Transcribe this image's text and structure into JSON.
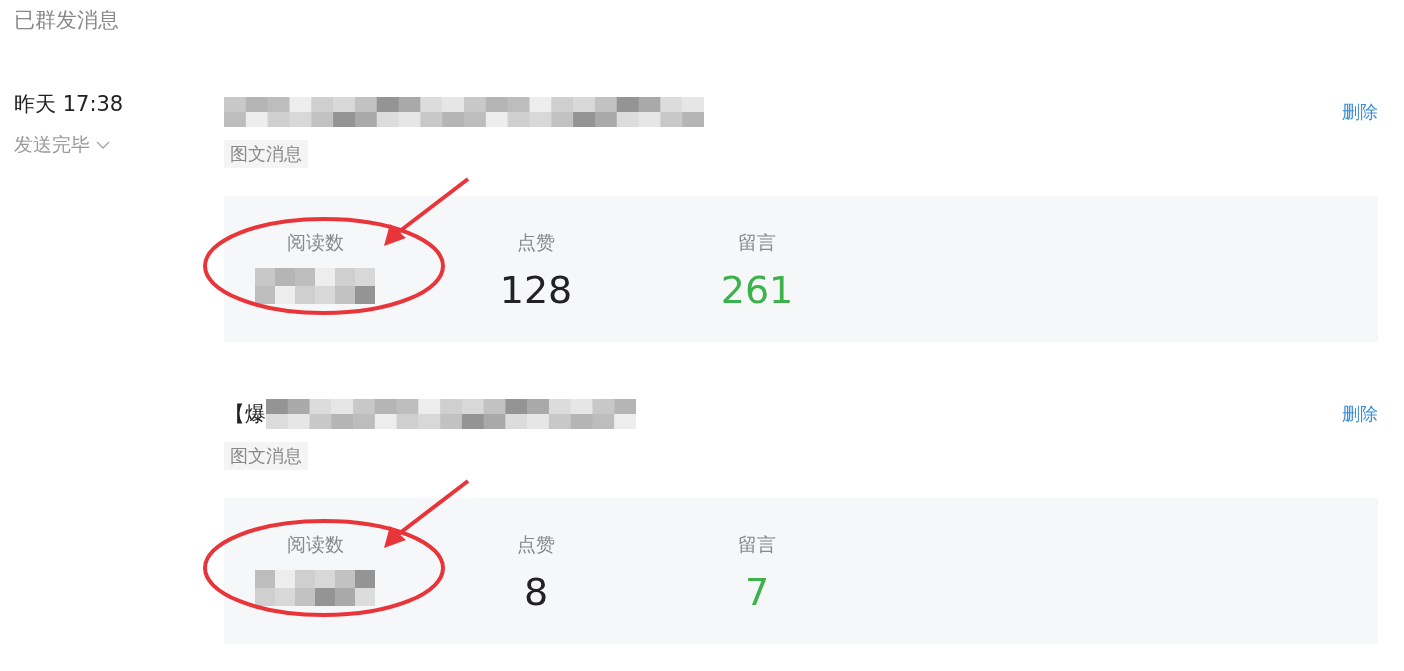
{
  "header": {
    "title": "已群发消息"
  },
  "batches": [
    {
      "time": "昨天 17:38",
      "status": "发送完毕",
      "messages": [
        {
          "type_tag": "图文消息",
          "action": "删除",
          "stats": [
            {
              "kind": "hidden",
              "label": "阅读数"
            },
            {
              "kind": "plain",
              "label": "点赞",
              "value": "128"
            },
            {
              "kind": "accent",
              "label": "留言",
              "value": "261"
            }
          ]
        },
        {
          "title_prefix": "【爆",
          "type_tag": "图文消息",
          "action": "删除",
          "stats": [
            {
              "kind": "hidden",
              "label": "阅读数"
            },
            {
              "kind": "plain",
              "label": "点赞",
              "value": "8"
            },
            {
              "kind": "accent",
              "label": "留言",
              "value": "7"
            }
          ]
        }
      ]
    }
  ]
}
